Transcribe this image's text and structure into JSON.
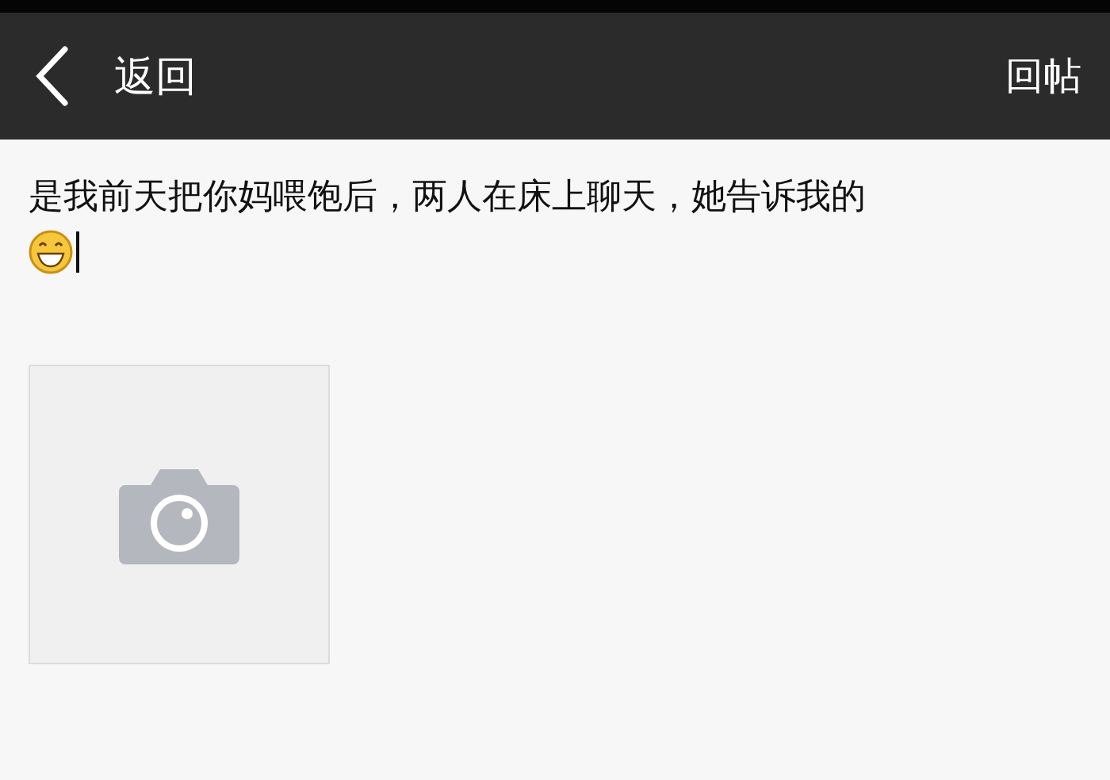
{
  "header": {
    "back_label": "返回",
    "action_label": "回帖"
  },
  "post": {
    "text": "是我前天把你妈喂饱后，两人在床上聊天，她告诉我的"
  },
  "attachments": [
    {
      "kind": "placeholder"
    }
  ]
}
